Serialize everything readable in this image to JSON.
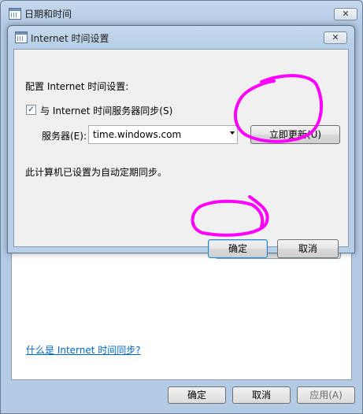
{
  "outer_window": {
    "title": "日期和时间",
    "close_symbol": "✕",
    "link_text": "什么是 Internet 时间同步?",
    "ok_label": "确定",
    "cancel_label": "取消",
    "apply_label": "应用(A)"
  },
  "dialog": {
    "title": "Internet 时间设置",
    "close_symbol": "✕",
    "config_label": "配置 Internet 时间设置:",
    "sync_checkbox_label": "与 Internet 时间服务器同步(S)",
    "sync_checked": true,
    "server_label": "服务器(E):",
    "server_value": "time.windows.com",
    "update_now_label": "立即更新(U)",
    "status_text": "此计算机已设置为自动定期同步。",
    "ok_label": "确定",
    "cancel_label": "取消"
  },
  "annotations": {
    "marker_color": "#ff00ff"
  }
}
